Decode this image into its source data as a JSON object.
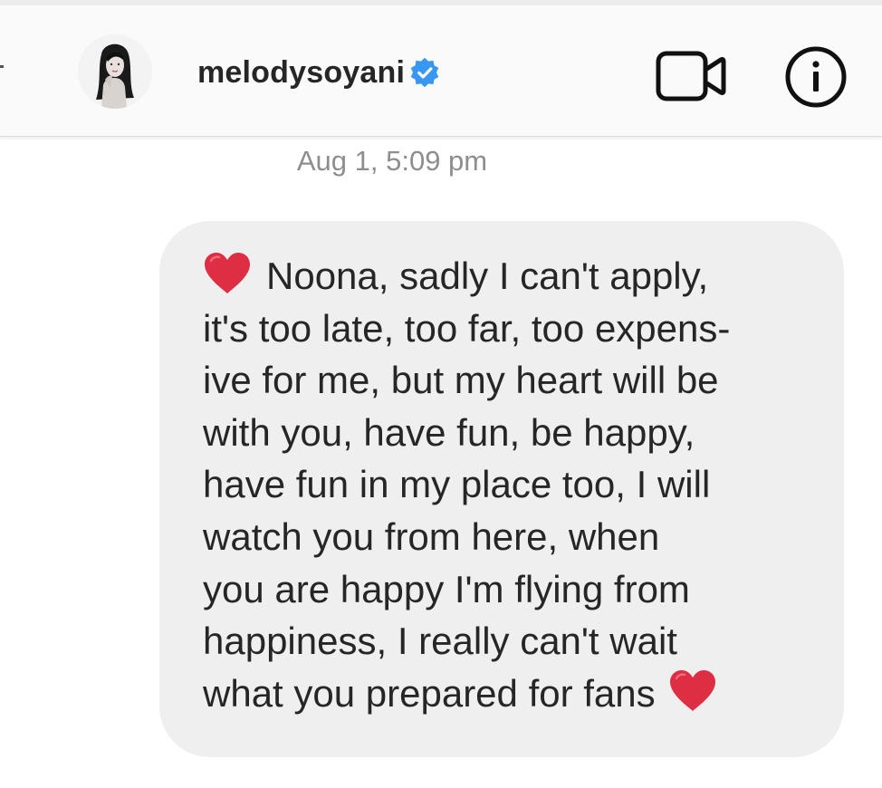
{
  "header": {
    "username": "melodysoyani",
    "verified_icon": "verified-badge-icon",
    "video_call_icon": "video-camera-icon",
    "info_icon": "info-icon"
  },
  "conversation": {
    "timestamp": "Aug 1, 5:09 pm",
    "message": {
      "lines": [
        "Noona, sadly I can't apply,",
        "it's too late, too far, too expens-",
        "ive for me, but my heart will be",
        "with you, have fun, be happy,",
        "have fun in my place too, I will",
        "watch you from here, when",
        "you are happy I'm flying from",
        "happiness, I really can't wait",
        "what you prepared for fans"
      ],
      "leading_emoji": "red-heart-icon",
      "trailing_emoji": "red-heart-icon"
    }
  },
  "colors": {
    "header_bg": "#fafafa",
    "bubble_bg": "#efefef",
    "text": "#262626",
    "timestamp": "#8e8e8e",
    "verified_blue": "#3897f0",
    "heart_red": "#dd2e44"
  }
}
